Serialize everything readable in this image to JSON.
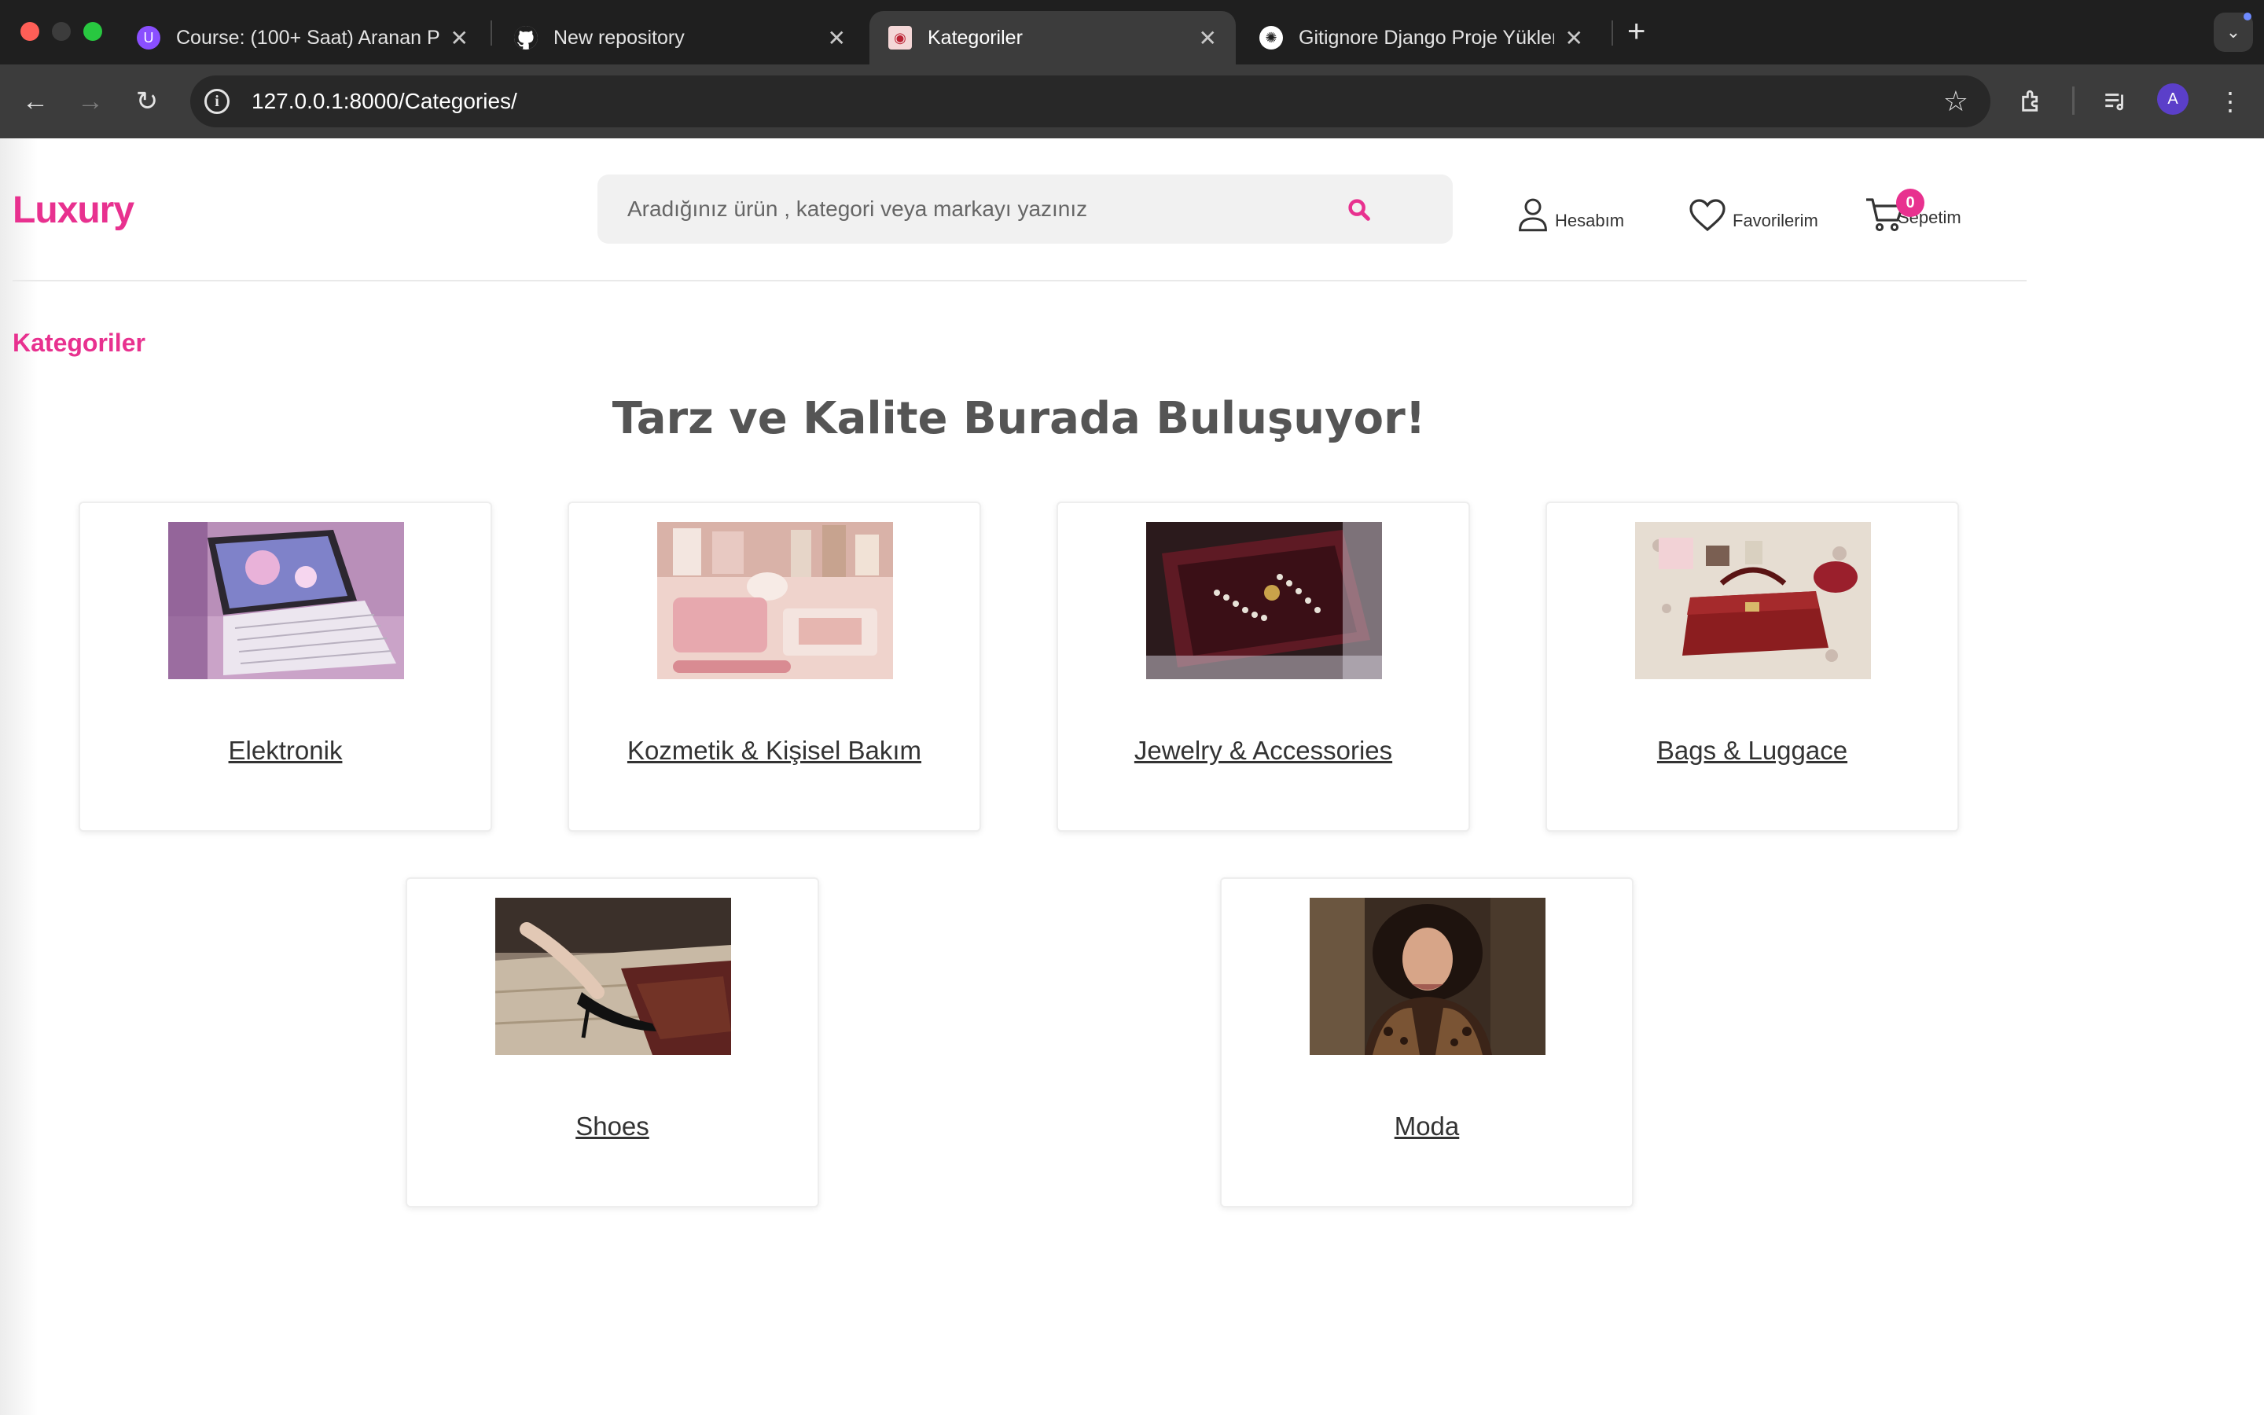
{
  "browser": {
    "tabs": [
      {
        "title": "Course: (100+ Saat) Aranan P",
        "favicon": "udemy-icon",
        "active": false
      },
      {
        "title": "New repository",
        "favicon": "github-icon",
        "active": false
      },
      {
        "title": "Kategoriler",
        "favicon": "site-favicon",
        "active": true
      },
      {
        "title": "Gitignore Django Proje Yükleme",
        "favicon": "chatgpt-icon",
        "active": false
      }
    ],
    "url": "127.0.0.1:8000/Categories/",
    "profile_initial": "A"
  },
  "header": {
    "logo": "Luxury",
    "search_placeholder": "Aradığınız ürün , kategori veya markayı yazınız",
    "account_label": "Hesabım",
    "favorites_label": "Favorilerim",
    "cart_label": "Sepetim",
    "cart_count": "0"
  },
  "page": {
    "section_title": "Kategoriler",
    "slogan": "Tarz ve Kalite Burada Buluşuyor!"
  },
  "categories": [
    {
      "name": "Elektronik",
      "image": "tablet-keyboard-photo"
    },
    {
      "name": "Kozmetik & Kişisel Bakım",
      "image": "cosmetics-photo"
    },
    {
      "name": "Jewelry & Accessories",
      "image": "jewelry-box-photo"
    },
    {
      "name": "Bags & Luggace",
      "image": "red-handbag-photo"
    },
    {
      "name": "Shoes",
      "image": "heels-photo"
    },
    {
      "name": "Moda",
      "image": "fashion-woman-photo"
    }
  ],
  "colors": {
    "brand": "#e8318f",
    "slogan": "#555555",
    "chrome_dark": "#1f1f1f",
    "chrome_toolbar": "#3c3c3c"
  }
}
